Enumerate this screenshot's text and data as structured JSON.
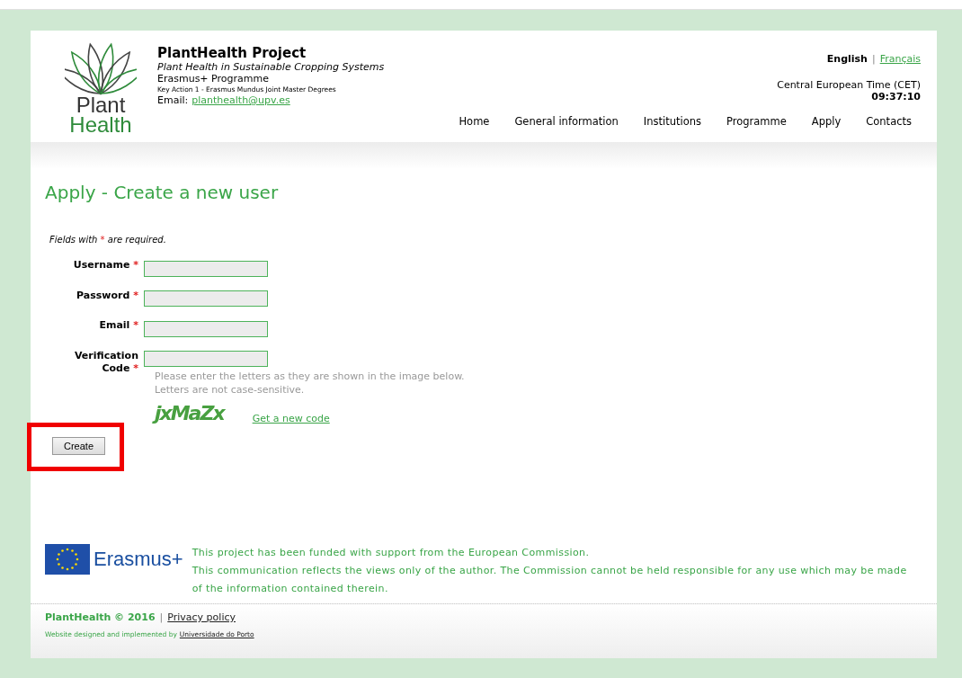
{
  "header": {
    "logo": {
      "line1": "Plant",
      "line2": "Health"
    },
    "title": "PlantHealth Project",
    "subtitle": "Plant Health in Sustainable Cropping Systems",
    "programme": "Erasmus+ Programme",
    "action": "Key Action 1 - Erasmus Mundus Joint Master Degrees",
    "email_label": "Email:",
    "email": "planthealth@upv.es",
    "languages": [
      {
        "label": "English",
        "selected": true
      },
      {
        "label": "Français",
        "selected": false
      }
    ],
    "language_separator": "|",
    "timezone": "Central European Time (CET)",
    "time": "09:37:10"
  },
  "nav": [
    {
      "label": "Home"
    },
    {
      "label": "General information"
    },
    {
      "label": "Institutions"
    },
    {
      "label": "Programme"
    },
    {
      "label": "Apply"
    },
    {
      "label": "Contacts"
    }
  ],
  "page_title": "Apply - Create a new user",
  "required_note": {
    "before": "Fields with",
    "mark": "*",
    "after": "are required."
  },
  "fields": [
    {
      "label": "Username",
      "required_mark": "*"
    },
    {
      "label": "Password",
      "required_mark": "*"
    },
    {
      "label": "Email",
      "required_mark": "*"
    },
    {
      "label": "Verification Code",
      "required_mark": "*"
    }
  ],
  "hint": "Please enter the letters as they are shown in the image below.\nLetters are not case-sensitive.",
  "captcha": "jxMaZx",
  "new_code_link": "Get a new code",
  "submit": "Create",
  "funding": {
    "logo_text": "Erasmus+",
    "lines": [
      "This project has been funded with support from the European Commission.",
      "This communication reflects the views only of the author. The Commission cannot be held responsible for any use which may be made of the information contained therein."
    ]
  },
  "footer": {
    "brand": "PlantHealth © 2016",
    "separator": "|",
    "privacy": "Privacy policy",
    "credit": "Website designed and implemented by",
    "credit_link": "Universidade do Porto"
  }
}
